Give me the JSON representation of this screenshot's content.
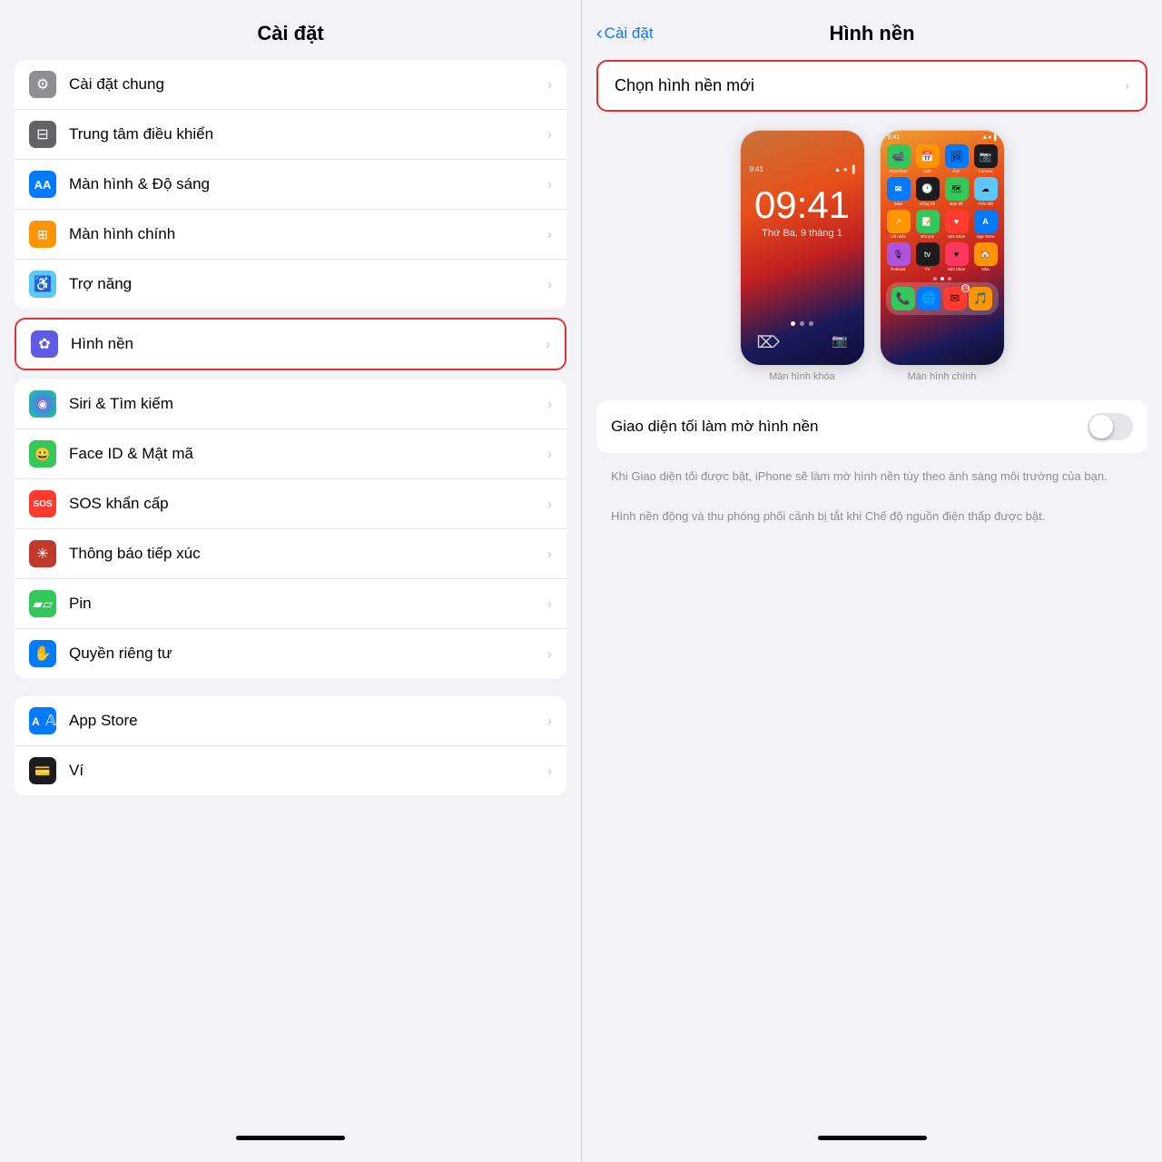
{
  "left": {
    "header": "Cài đặt",
    "group1": [
      {
        "id": "cai-dat-chung",
        "icon": "⚙️",
        "iconBg": "icon-gray",
        "label": "Cài đặt chung",
        "unicode": "⚙"
      },
      {
        "id": "trung-tam-dieu-khien",
        "icon": "🎛",
        "iconBg": "icon-gray2",
        "label": "Trung tâm điều khiển",
        "unicode": "⊟"
      },
      {
        "id": "man-hinh-do-sang",
        "icon": "AA",
        "iconBg": "icon-blue",
        "label": "Màn hình & Độ sáng",
        "unicode": "AA"
      },
      {
        "id": "man-hinh-chinh",
        "icon": "⊞",
        "iconBg": "icon-orange",
        "label": "Màn hình chính",
        "unicode": "⊞"
      },
      {
        "id": "tro-nang",
        "icon": "♿",
        "iconBg": "icon-teal",
        "label": "Trợ năng",
        "unicode": "♿"
      }
    ],
    "highlighted": {
      "id": "hinh-nen",
      "icon": "✿",
      "iconBg": "icon-purple2",
      "label": "Hình nền"
    },
    "group2": [
      {
        "id": "siri-tim-kiem",
        "iconBg": "icon-dark",
        "label": "Siri & Tìm kiếm",
        "unicode": "🌐"
      },
      {
        "id": "face-id-mat-ma",
        "iconBg": "icon-green",
        "label": "Face ID & Mật mã",
        "unicode": "😀"
      },
      {
        "id": "sos-khan-cap",
        "iconBg": "icon-red-bg",
        "label": "SOS khẩn cấp",
        "unicode": "SOS"
      },
      {
        "id": "thong-bao-tiep-xuc",
        "iconBg": "icon-dark-red",
        "label": "Thông báo tiếp xúc",
        "unicode": "✳"
      },
      {
        "id": "pin",
        "iconBg": "icon-green",
        "label": "Pin",
        "unicode": "🔋"
      },
      {
        "id": "quyen-rieng-tu",
        "iconBg": "icon-blue2",
        "label": "Quyền riêng tư",
        "unicode": "✋"
      }
    ],
    "group3": [
      {
        "id": "app-store",
        "iconBg": "icon-appstore",
        "label": "App Store",
        "unicode": "A"
      },
      {
        "id": "vi",
        "iconBg": "icon-dark",
        "label": "Ví",
        "unicode": "💳"
      }
    ]
  },
  "right": {
    "back_label": "Cài đặt",
    "title": "Hình nền",
    "choose_wallpaper": "Chọn hình nền mới",
    "lock_time": "09:41",
    "lock_date": "Thứ Ba, 9 tháng 1",
    "toggle_label": "Giao diện tối làm mờ hình nền",
    "toggle_on": false,
    "desc1": "Khi Giao diện tối được bật, iPhone sẽ làm mờ hình nền tùy theo ánh sáng môi trường của bạn.",
    "desc2": "Hình nền động và thu phóng phối cảnh bị tắt khi Chế độ nguồn điện thấp được bật."
  }
}
